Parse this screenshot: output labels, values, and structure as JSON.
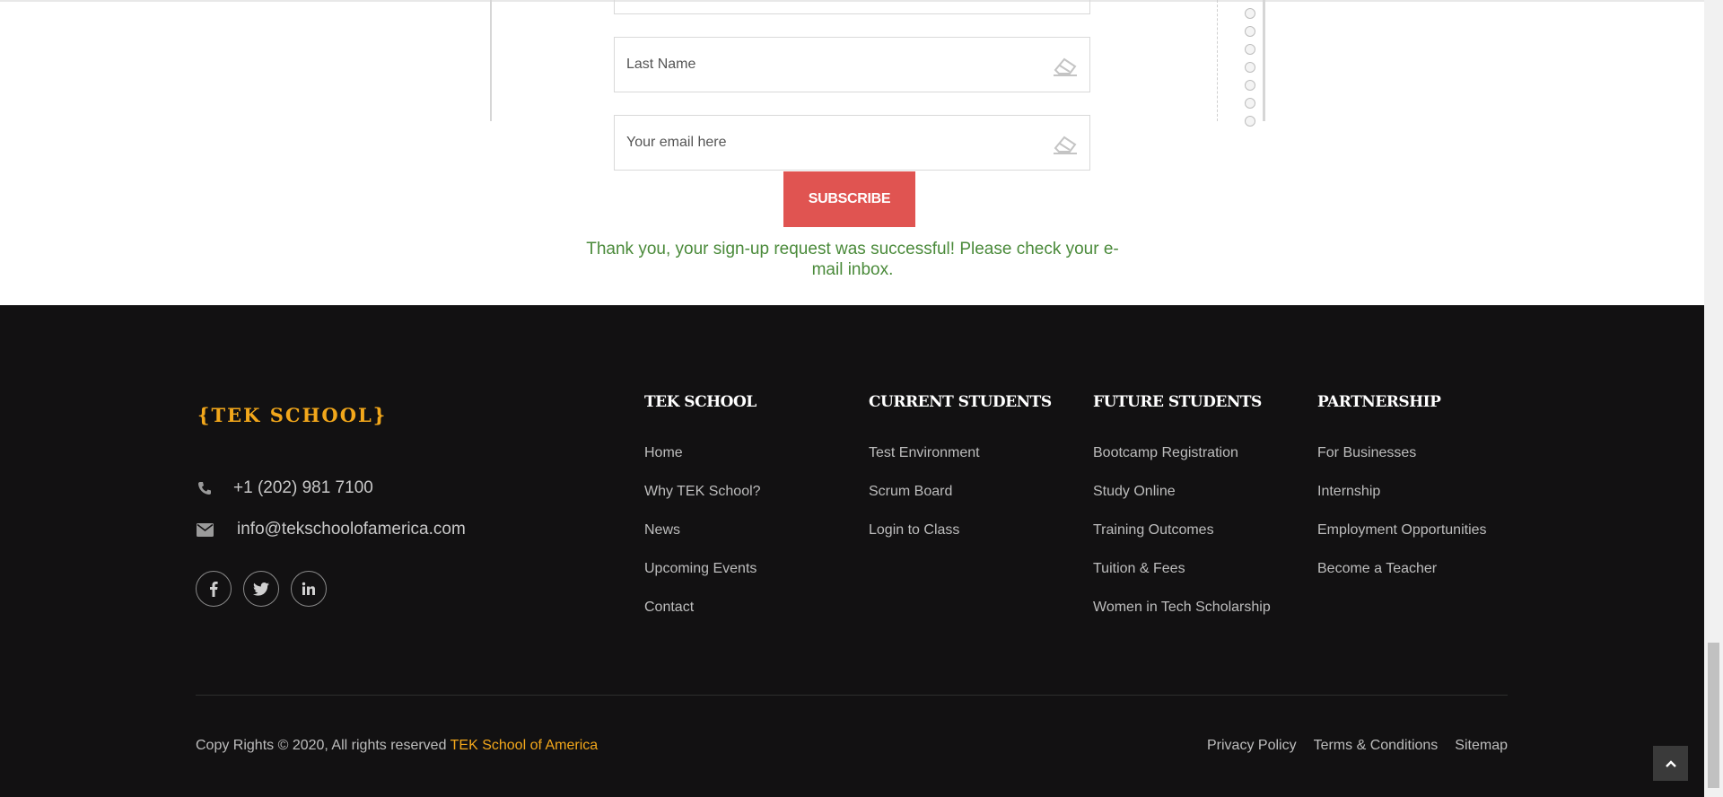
{
  "form": {
    "last_name_placeholder": "Last Name",
    "email_placeholder": "Your email here",
    "subscribe_label": "SUBSCRIBE",
    "success_message": "Thank you, your sign-up request was successful! Please check your e-mail inbox."
  },
  "footer": {
    "logo": "{TEK SCHOOL}",
    "phone": "+1 (202) 981 7100",
    "email": "info@tekschoolofamerica.com",
    "social_icons": [
      "facebook-icon",
      "twitter-icon",
      "linkedin-icon"
    ],
    "columns": [
      {
        "title": "TEK SCHOOL",
        "links": [
          "Home",
          "Why TEK School?",
          "News",
          "Upcoming Events",
          "Contact"
        ]
      },
      {
        "title": "CURRENT STUDENTS",
        "links": [
          "Test Environment",
          "Scrum Board",
          "Login to Class"
        ]
      },
      {
        "title": "FUTURE STUDENTS",
        "links": [
          "Bootcamp Registration",
          "Study Online",
          "Training Outcomes",
          "Tuition & Fees",
          "Women in Tech Scholarship"
        ]
      },
      {
        "title": "PARTNERSHIP",
        "links": [
          "For Businesses",
          "Internship",
          "Employment Opportunities",
          "Become a Teacher"
        ]
      }
    ],
    "copyright_text": "Copy Rights © 2020, All rights reserved ",
    "copyright_brand": "TEK School of America",
    "legal_links": [
      "Privacy Policy",
      "Terms & Conditions",
      "Sitemap"
    ]
  },
  "colors": {
    "accent": "#f2a71b",
    "subscribe": "#e05451",
    "success": "#4a8a3a",
    "footer_bg": "#121112"
  }
}
